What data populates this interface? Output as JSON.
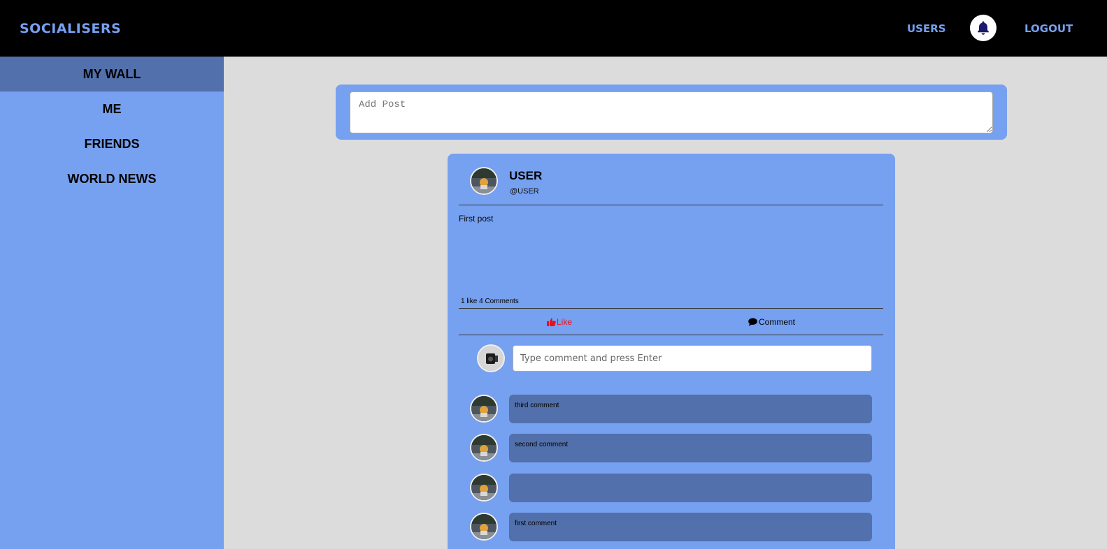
{
  "header": {
    "brand": "SOCIALISERS",
    "users_link": "USERS",
    "logout_link": "LOGOUT",
    "notification_icon": "bell-icon"
  },
  "sidebar": {
    "items": [
      {
        "label": "MY WALL",
        "active": true
      },
      {
        "label": "ME"
      },
      {
        "label": "FRIENDS"
      },
      {
        "label": "WORLD NEWS"
      }
    ]
  },
  "add_post": {
    "placeholder": "Add Post"
  },
  "post": {
    "author_name": "USER",
    "author_handle": "@USER",
    "text": "First post",
    "stats": "1 like 4 Comments",
    "like_label": "Like",
    "comment_label": "Comment",
    "comment_input_placeholder": "Type comment and press Enter",
    "comments": [
      {
        "text": "third comment"
      },
      {
        "text": "second comment"
      },
      {
        "text": ""
      },
      {
        "text": "first comment"
      }
    ]
  },
  "colors": {
    "accent": "#76a0f0",
    "active": "#5270ab",
    "like": "#e8101c",
    "topbar": "#000000"
  }
}
